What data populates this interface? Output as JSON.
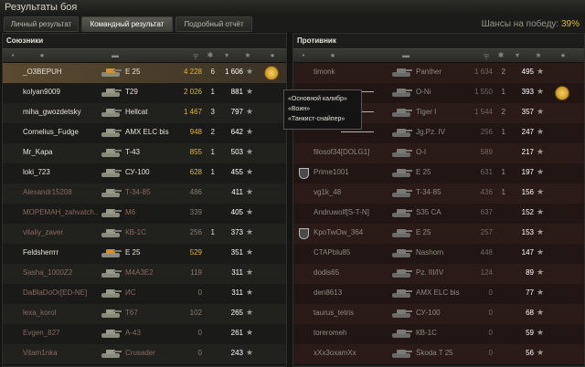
{
  "window": {
    "title": "Результаты боя"
  },
  "tabs": [
    "Личный результат",
    "Командный результат",
    "Подробный отчёт"
  ],
  "chance": {
    "label": "Шансы на победу:",
    "value": "39%"
  },
  "allies": {
    "title": "Союзники",
    "rows": [
      {
        "name": "_O3BEPUH",
        "vehicle": "E 25",
        "damage": "4 228",
        "frags": "6",
        "xp": "1 606",
        "medal": true,
        "highlight": true
      },
      {
        "name": "kolyan9009",
        "vehicle": "T29",
        "damage": "2 026",
        "frags": "1",
        "xp": "881"
      },
      {
        "name": "miha_gwozdetsky",
        "vehicle": "Hellcat",
        "damage": "1 467",
        "frags": "3",
        "xp": "797"
      },
      {
        "name": "Cornelius_Fudge",
        "vehicle": "AMX ELC bis",
        "damage": "948",
        "frags": "2",
        "xp": "642"
      },
      {
        "name": "Mr_Kapa",
        "vehicle": "T-43",
        "damage": "855",
        "frags": "1",
        "xp": "503"
      },
      {
        "name": "loki_723",
        "vehicle": "СУ-100",
        "damage": "628",
        "frags": "1",
        "xp": "455"
      },
      {
        "name": "Alexandr15208",
        "vehicle": "T-34-85",
        "damage": "486",
        "frags": "",
        "xp": "411",
        "dead": true
      },
      {
        "name": "МОРЕМАН_zahvatch...",
        "vehicle": "M6",
        "damage": "339",
        "frags": "",
        "xp": "405",
        "dead": true
      },
      {
        "name": "vitaliy_zaver",
        "vehicle": "КВ-1С",
        "damage": "256",
        "frags": "1",
        "xp": "373",
        "dead": true
      },
      {
        "name": "Feldsherrrr",
        "vehicle": "E 25",
        "damage": "529",
        "frags": "",
        "xp": "351"
      },
      {
        "name": "Sasha_1000Z2",
        "vehicle": "M4A3E2",
        "damage": "119",
        "frags": "",
        "xp": "311",
        "dead": true
      },
      {
        "name": "DaBlaDoOr[ED-NE]",
        "vehicle": "ИС",
        "damage": "0",
        "frags": "",
        "xp": "311",
        "dead": true
      },
      {
        "name": "lexa_korol",
        "vehicle": "T67",
        "damage": "102",
        "frags": "",
        "xp": "265",
        "dead": true
      },
      {
        "name": "Evgen_827",
        "vehicle": "A-43",
        "damage": "0",
        "frags": "",
        "xp": "261",
        "dead": true
      },
      {
        "name": "Vitam1nka",
        "vehicle": "Crusader",
        "damage": "0",
        "frags": "",
        "xp": "243",
        "dead": true
      }
    ]
  },
  "enemies": {
    "title": "Противник",
    "rows": [
      {
        "name": "timonk",
        "vehicle": "Panther",
        "damage": "1 634",
        "frags": "2",
        "xp": "495",
        "dead": true
      },
      {
        "name": "",
        "vehicle": "O-Ni",
        "damage": "1 550",
        "frags": "1",
        "xp": "393",
        "medal": true,
        "dead": true
      },
      {
        "name": "",
        "vehicle": "Tiger I",
        "damage": "1 544",
        "frags": "2",
        "xp": "357",
        "dead": true
      },
      {
        "name": "",
        "vehicle": "Jg.Pz. IV",
        "damage": "256",
        "frags": "1",
        "xp": "247",
        "dead": true
      },
      {
        "name": "filosof34[DOLG1]",
        "vehicle": "O-I",
        "damage": "589",
        "frags": "",
        "xp": "217",
        "dead": true
      },
      {
        "name": "Prime1001",
        "vehicle": "E 25",
        "damage": "631",
        "frags": "1",
        "xp": "197",
        "dead": true,
        "clan": true
      },
      {
        "name": "vg1k_48",
        "vehicle": "T-34-85",
        "damage": "436",
        "frags": "1",
        "xp": "156",
        "dead": true
      },
      {
        "name": "Andruwolf[S-T-N]",
        "vehicle": "S35 CA",
        "damage": "637",
        "frags": "",
        "xp": "152",
        "dead": true
      },
      {
        "name": "KpoTwOw_364",
        "vehicle": "E 25",
        "damage": "257",
        "frags": "",
        "xp": "153",
        "dead": true,
        "clan": true
      },
      {
        "name": "CTAPblu85",
        "vehicle": "Nashorn",
        "damage": "448",
        "frags": "",
        "xp": "147",
        "dead": true
      },
      {
        "name": "dodis65",
        "vehicle": "Pz. III/IV",
        "damage": "124",
        "frags": "",
        "xp": "89",
        "dead": true
      },
      {
        "name": "den8613",
        "vehicle": "AMX ELC bis",
        "damage": "0",
        "frags": "",
        "xp": "77",
        "dead": true
      },
      {
        "name": "taurus_tetris",
        "vehicle": "СУ-100",
        "damage": "0",
        "frags": "",
        "xp": "68",
        "dead": true
      },
      {
        "name": "toreromeh",
        "vehicle": "КВ-1С",
        "damage": "0",
        "frags": "",
        "xp": "59",
        "dead": true
      },
      {
        "name": "xXx3oxamXx",
        "vehicle": "Škoda T 25",
        "damage": "0",
        "frags": "",
        "xp": "56",
        "dead": true
      }
    ]
  },
  "tooltip": {
    "lines": [
      "«Основной калибр»",
      "«Воин»",
      "«Танкист-снайпер»"
    ]
  },
  "colors": {
    "accent": "#e2b82b",
    "ally_alive": "#e8e4d8",
    "dead": "#8c6a5e",
    "enemy_dead": "#8f8a80"
  }
}
